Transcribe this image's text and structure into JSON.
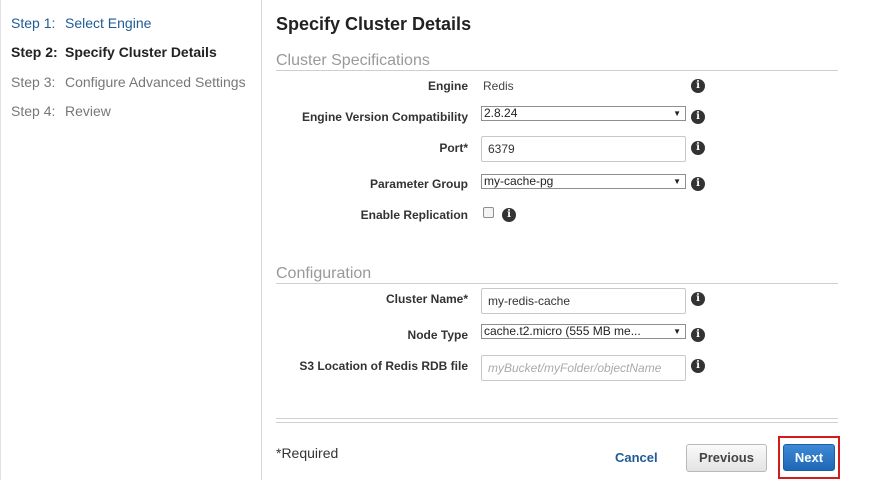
{
  "wizard": {
    "steps": [
      {
        "num": "Step 1:",
        "label": "Select Engine"
      },
      {
        "num": "Step 2:",
        "label": "Specify Cluster Details"
      },
      {
        "num": "Step 3:",
        "label": "Configure Advanced Settings"
      },
      {
        "num": "Step 4:",
        "label": "Review"
      }
    ]
  },
  "page": {
    "title": "Specify Cluster Details"
  },
  "cluster_specifications": {
    "title": "Cluster Specifications",
    "engine": {
      "label": "Engine",
      "value": "Redis"
    },
    "engine_version": {
      "label": "Engine Version Compatibility",
      "value": "2.8.24"
    },
    "port": {
      "label": "Port*",
      "value": "6379"
    },
    "parameter_group": {
      "label": "Parameter Group",
      "value": "my-cache-pg"
    },
    "enable_replication": {
      "label": "Enable Replication",
      "checked": false
    }
  },
  "configuration": {
    "title": "Configuration",
    "cluster_name": {
      "label": "Cluster Name*",
      "value": "my-redis-cache"
    },
    "node_type": {
      "label": "Node Type",
      "value": "cache.t2.micro (555 MB me..."
    },
    "s3_location": {
      "label": "S3 Location of Redis RDB file",
      "placeholder": "myBucket/myFolder/objectName",
      "value": ""
    }
  },
  "footer": {
    "required_note": "*Required",
    "cancel_label": "Cancel",
    "previous_label": "Previous",
    "next_label": "Next"
  },
  "icons": {
    "info": "info-icon",
    "caret": "caret-down-icon"
  },
  "colors": {
    "link": "#1f5b94",
    "primary_button": "#2a74c2",
    "highlight": "#d21b1b"
  }
}
